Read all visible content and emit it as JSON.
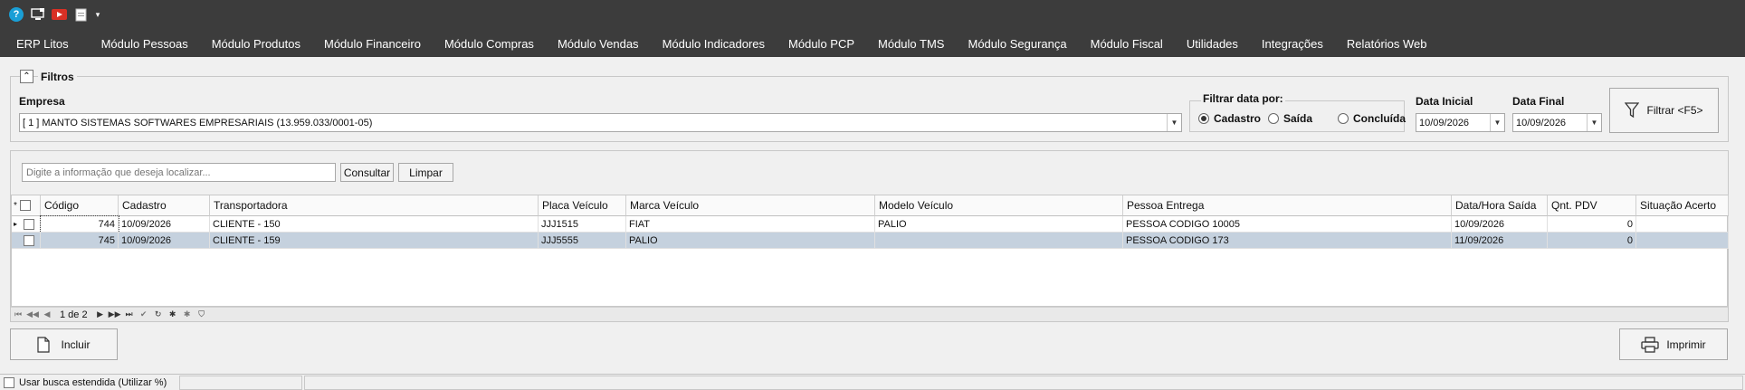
{
  "quick_access": {
    "help_glyph": "?",
    "dropdown_glyph": "▾"
  },
  "menu": [
    "ERP Litos",
    "Módulo Pessoas",
    "Módulo Produtos",
    "Módulo Financeiro",
    "Módulo Compras",
    "Módulo Vendas",
    "Módulo Indicadores",
    "Módulo PCP",
    "Módulo TMS",
    "Módulo Segurança",
    "Módulo Fiscal",
    "Utilidades",
    "Integrações",
    "Relatórios Web"
  ],
  "filtros": {
    "title": "Filtros",
    "collapse_glyph": "⌃",
    "empresa_label": "Empresa",
    "empresa_value": "[ 1 ] MANTO SISTEMAS SOFTWARES EMPRESARIAIS (13.959.033/0001-05)",
    "filtrar_por_label": "Filtrar data por:",
    "radio_options": [
      "Cadastro",
      "Saída",
      "Concluída"
    ],
    "radio_selected": "Cadastro",
    "data_inicial_label": "Data Inicial",
    "data_inicial_value": "10/09/2026",
    "data_final_label": "Data Final",
    "data_final_value": "10/09/2026",
    "filtrar_button": "Filtrar <F5>"
  },
  "search": {
    "placeholder": "Digite a informação que deseja localizar...",
    "consultar_button": "Consultar",
    "limpar_button": "Limpar"
  },
  "grid": {
    "indicator_glyph": "*",
    "columns": [
      "Código",
      "Cadastro",
      "Transportadora",
      "Placa Veículo",
      "Marca Veículo",
      "Modelo Veículo",
      "Pessoa Entrega",
      "Data/Hora Saída",
      "Qnt. PDV",
      "Situação Acerto"
    ],
    "rows": [
      {
        "codigo": "744",
        "cadastro": "10/09/2026",
        "transportadora": "CLIENTE - 150",
        "placa": "JJJ1515",
        "marca": "FIAT",
        "modelo": "PALIO",
        "pessoa": "PESSOA CODIGO 10005",
        "saida": "10/09/2026",
        "qnt": "0",
        "situacao": ""
      },
      {
        "codigo": "745",
        "cadastro": "10/09/2026",
        "transportadora": "CLIENTE - 159",
        "placa": "JJJ5555",
        "marca": "PALIO",
        "modelo": "",
        "pessoa": "PESSOA CODIGO 173",
        "saida": "11/09/2026",
        "qnt": "0",
        "situacao": ""
      }
    ],
    "current_row_glyph": "▸",
    "pager_text": "1 de 2",
    "selected_row_color": "#c5d1de"
  },
  "actions": {
    "incluir_button": "Incluir",
    "imprimir_button": "Imprimir"
  },
  "status": {
    "busca_estendida_label": "Usar busca estendida (Utilizar %)"
  },
  "colors": {
    "menubar_bg": "#3c3c3c",
    "panel_bg": "#f0f0f0",
    "help_icon": "#1a9fd6",
    "video_icon": "#d93025"
  }
}
